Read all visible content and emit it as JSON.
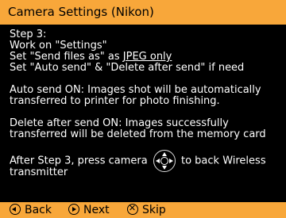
{
  "title": "Camera Settings (Nikon)",
  "content": {
    "step_heading": "Step 3:",
    "line1": "Work on \"Settings\"",
    "line2_prefix": "Set \"Send files as\" as ",
    "line2_emph": "JPEG only",
    "line3": "Set \"Auto send\" & \"Delete after send\" if need",
    "auto_send_line1": "Auto send ON: Images shot will be automatically",
    "auto_send_line2": "transferred to printer for photo finishing.",
    "delete_line1": "Delete after send ON: Images successfully",
    "delete_line2": "transferred will be deleted from the memory card",
    "after_prefix": "After Step 3, press camera",
    "after_suffix": "to back Wireless",
    "after_line2": "transmitter"
  },
  "nav": {
    "back": "Back",
    "next": "Next",
    "skip": "Skip"
  },
  "colors": {
    "accent": "#f8a73a",
    "background": "#000000",
    "text": "#ffffff"
  },
  "icons": {
    "dial": "multi-selector-icon",
    "back": "back-circle-icon",
    "next": "next-circle-icon",
    "skip": "skip-circle-icon"
  }
}
